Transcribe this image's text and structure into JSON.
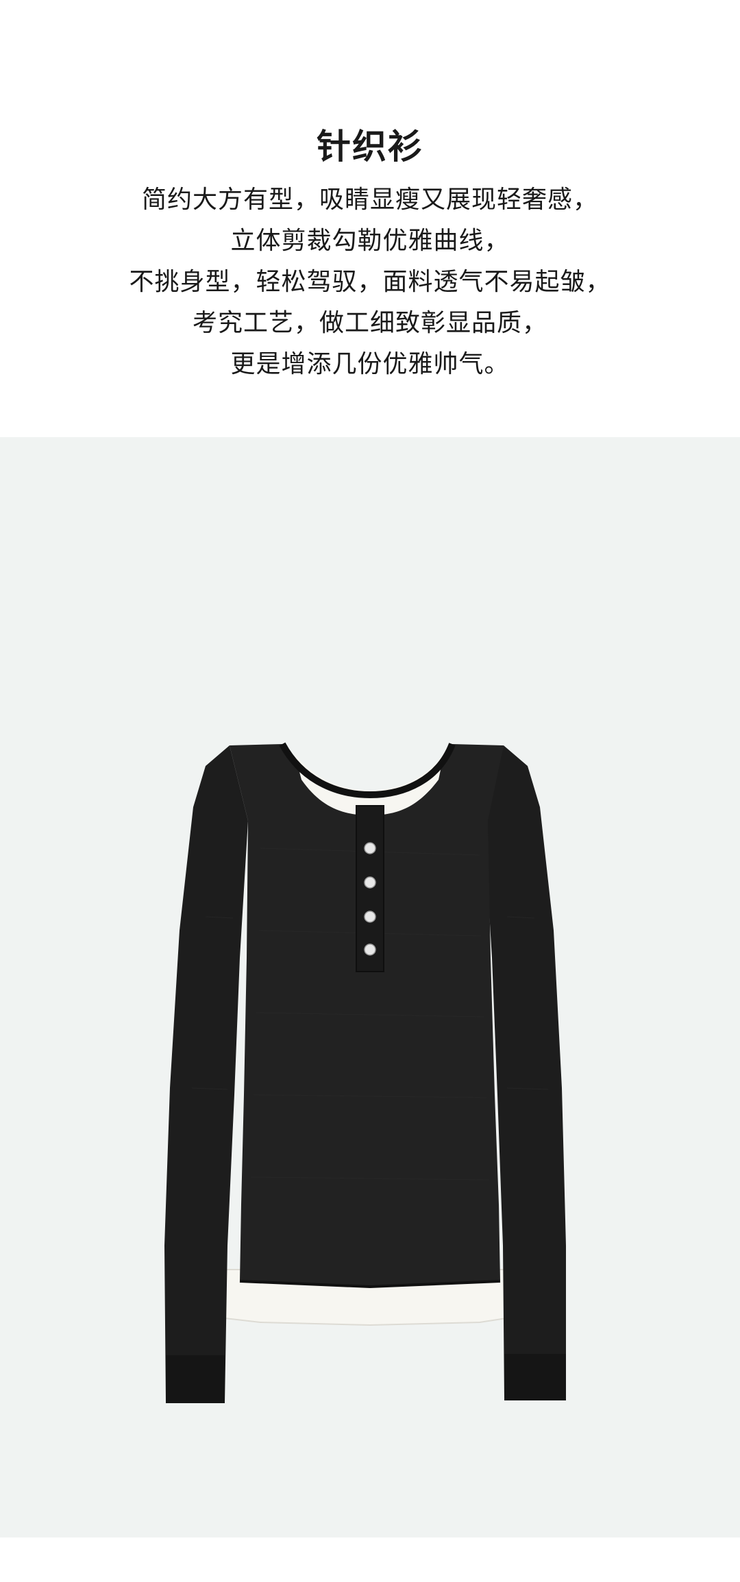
{
  "product": {
    "title": "针织衫",
    "description_lines": [
      "简约大方有型，吸睛显瘦又展现轻奢感，",
      "立体剪裁勾勒优雅曲线，",
      "不挑身型，轻松驾驭，面料透气不易起皱，",
      "考究工艺，做工细致彰显品质，",
      "更是增添几份优雅帅气。"
    ]
  },
  "colors": {
    "photo_background": "#f0f3f2",
    "garment": "#1d1d1d",
    "undershirt": "#f7f6f1",
    "buttons": "#e8e8e8"
  },
  "image": {
    "subject": "black-long-sleeve-henley-top-icon"
  }
}
